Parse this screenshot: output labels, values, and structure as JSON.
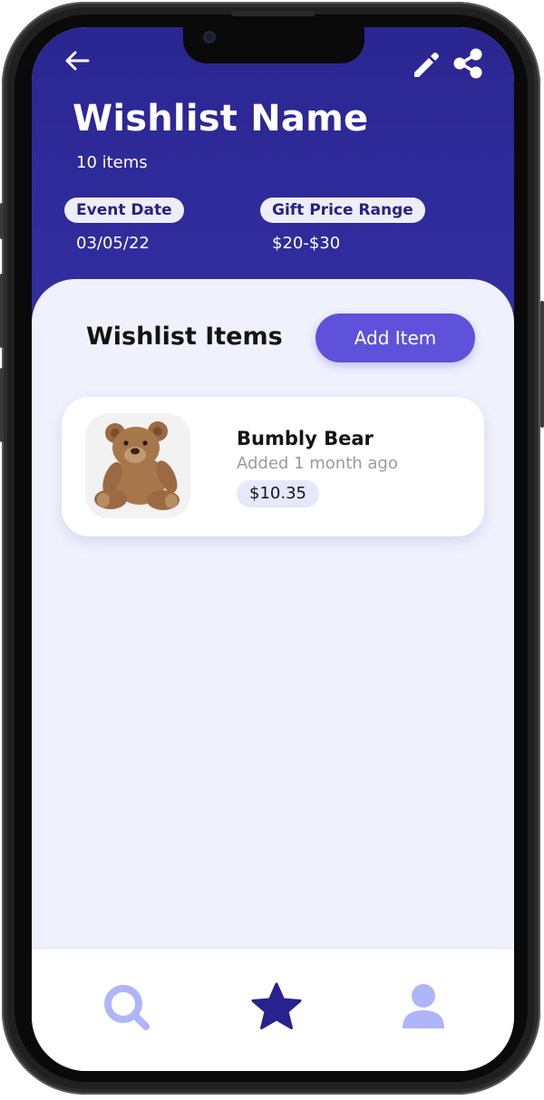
{
  "header": {
    "title": "Wishlist Name",
    "item_count": "10 items",
    "event_date_label": "Event Date",
    "event_date_value": "03/05/22",
    "price_range_label": "Gift Price Range",
    "price_range_value": "$20-$30",
    "icons": {
      "back": "arrow-left-icon",
      "edit": "pencil-icon",
      "share": "share-icon"
    }
  },
  "wishlist": {
    "section_title": "Wishlist Items",
    "add_button_label": "Add Item",
    "items": [
      {
        "name": "Bumbly Bear",
        "added": "Added 1 month ago",
        "price": "$10.35",
        "image": "teddy-bear-image"
      }
    ]
  },
  "nav": {
    "items": [
      {
        "name": "search",
        "icon": "search-icon",
        "active": false
      },
      {
        "name": "favorites",
        "icon": "star-icon",
        "active": true
      },
      {
        "name": "profile",
        "icon": "user-icon",
        "active": false
      }
    ]
  },
  "colors": {
    "header_bg": "#2a2691",
    "accent": "#5d52d9",
    "pill_bg": "#eeeefb",
    "panel_bg": "#eff1fd",
    "nav_active": "#28238f",
    "nav_inactive": "#aeb6f7"
  }
}
